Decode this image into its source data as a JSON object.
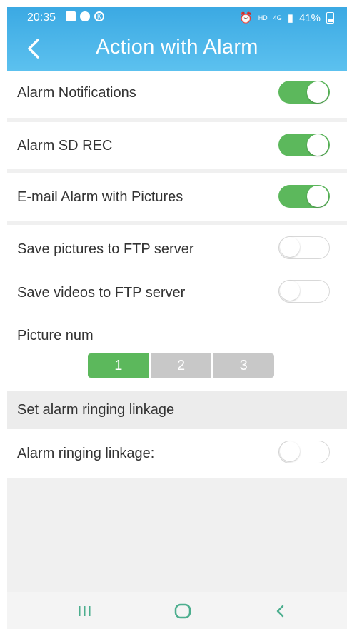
{
  "status_bar": {
    "time": "20:35",
    "left_icons": [
      "gallery-icon",
      "circle-app-icon",
      "k-app-icon"
    ],
    "hd_label": "HD",
    "network_label": "4G",
    "battery": "41%"
  },
  "header": {
    "title": "Action with Alarm",
    "back_icon": "chevron-left-icon"
  },
  "settings": {
    "alarm_notifications": {
      "label": "Alarm Notifications",
      "enabled": true
    },
    "alarm_sd_rec": {
      "label": "Alarm SD REC",
      "enabled": true
    },
    "email_alarm": {
      "label": "E-mail Alarm with Pictures",
      "enabled": true
    },
    "ftp_pictures": {
      "label": "Save pictures to FTP server",
      "enabled": false
    },
    "ftp_videos": {
      "label": "Save videos to FTP server",
      "enabled": false
    },
    "picture_num": {
      "label": "Picture num",
      "options": [
        "1",
        "2",
        "3"
      ],
      "selected": "1"
    }
  },
  "linkage_section": {
    "header": "Set alarm ringing linkage",
    "ringing_linkage": {
      "label": "Alarm ringing linkage:",
      "enabled": false
    }
  },
  "nav": {
    "recents_icon": "recents-icon",
    "home_icon": "home-icon",
    "back_icon": "back-chevron-icon"
  },
  "colors": {
    "header": "#3ba9e3",
    "toggle_on": "#5cb85c",
    "nav_icon": "#4cae8e"
  }
}
